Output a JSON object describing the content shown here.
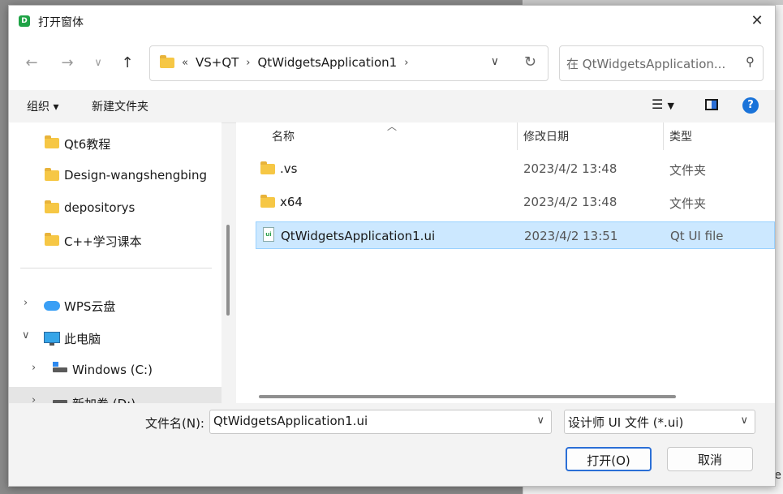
{
  "window": {
    "title": "打开窗体",
    "app_icon_letter": "D"
  },
  "address": {
    "crumbs": [
      "«",
      "VS+QT",
      "QtWidgetsApplication1"
    ],
    "search_placeholder": "在 QtWidgetsApplication..."
  },
  "toolbar": {
    "organize_label": "组织 ▾",
    "new_folder_label": "新建文件夹",
    "help_label": "?"
  },
  "sidebar": {
    "items": [
      {
        "label": "Qt6教程",
        "icon": "folder-icon"
      },
      {
        "label": "Design-wangshengbing",
        "icon": "folder-icon"
      },
      {
        "label": "depositorys",
        "icon": "folder-icon"
      },
      {
        "label": "C++学习课本",
        "icon": "folder-icon"
      },
      {
        "label": "WPS云盘",
        "icon": "cloud-icon"
      },
      {
        "label": "此电脑",
        "icon": "computer-icon"
      },
      {
        "label": "Windows (C:)",
        "icon": "drive-icon"
      },
      {
        "label": "新加卷 (D:)",
        "icon": "drive-icon"
      }
    ]
  },
  "columns": {
    "name": "名称",
    "modified": "修改日期",
    "type": "类型"
  },
  "files": [
    {
      "name": ".vs",
      "date": "2023/4/2 13:48",
      "type": "文件夹",
      "icon": "folder-icon"
    },
    {
      "name": "x64",
      "date": "2023/4/2 13:48",
      "type": "文件夹",
      "icon": "folder-icon"
    },
    {
      "name": "QtWidgetsApplication1.ui",
      "date": "2023/4/2 13:51",
      "type": "Qt UI file",
      "icon": "ui-file-icon",
      "selected": true
    }
  ],
  "footer": {
    "filename_label": "文件名(N):",
    "filename_value": "QtWidgetsApplication1.ui",
    "filter_value": "设计师 UI 文件 (*.ui)",
    "open_label": "打开(O)",
    "cancel_label": "取消"
  },
  "background": {
    "edge_text": "e"
  },
  "colors": {
    "accent": "#2b6fd6",
    "selection": "#cce8ff",
    "folder": "#f6c745"
  }
}
